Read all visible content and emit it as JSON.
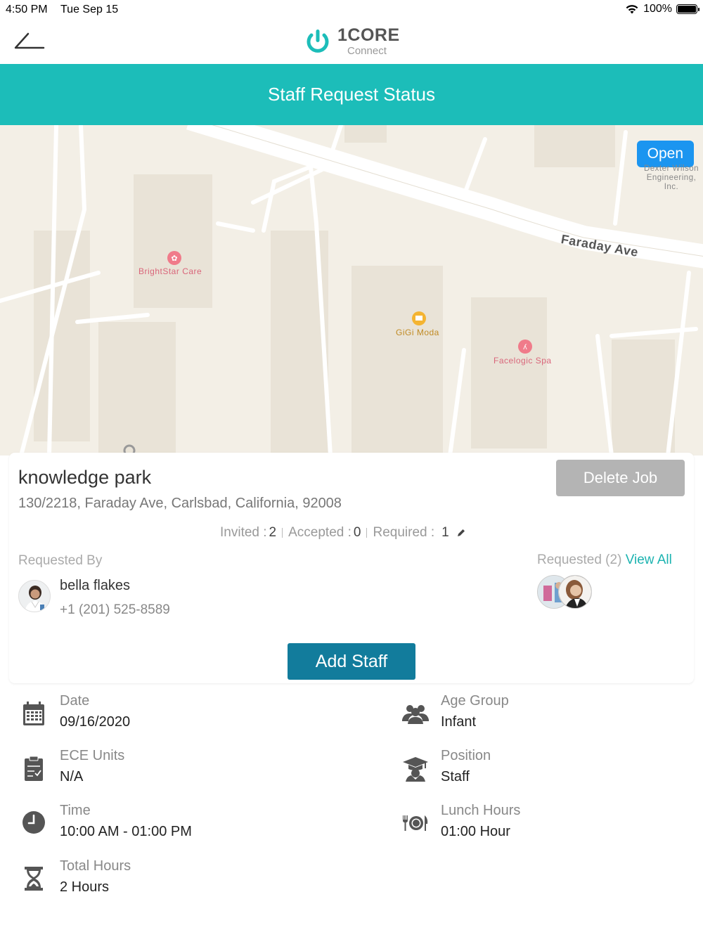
{
  "status_bar": {
    "time": "4:50 PM",
    "date": "Tue Sep 15",
    "battery": "100%"
  },
  "nav": {
    "logo_main": "1CORE",
    "logo_sub": "Connect"
  },
  "header": {
    "title": "Staff Request Status"
  },
  "map": {
    "open_label": "Open",
    "street": "Faraday Ave",
    "pois": [
      {
        "name": "BrightStar Care"
      },
      {
        "name": "GiGi Moda"
      },
      {
        "name": "Facelogic Spa"
      },
      {
        "name": "Dexter Wilson Engineering, Inc."
      }
    ]
  },
  "job": {
    "title": "knowledge park",
    "address": "130/2218, Faraday Ave, Carlsbad, California, 92008",
    "delete_label": "Delete Job",
    "invited_label": "Invited :",
    "invited_count": "2",
    "accepted_label": "Accepted :",
    "accepted_count": "0",
    "required_label": "Required :",
    "required_count": "1",
    "requested_by_label": "Requested By",
    "requester_name": "bella flakes",
    "requester_phone": "+1 (201) 525-8589",
    "requested_label": "Requested (2)",
    "view_all_label": "View All",
    "add_staff_label": "Add Staff"
  },
  "details": {
    "date": {
      "label": "Date",
      "value": "09/16/2020"
    },
    "age_group": {
      "label": "Age Group",
      "value": "Infant"
    },
    "ece_units": {
      "label": "ECE Units",
      "value": "N/A"
    },
    "position": {
      "label": "Position",
      "value": "Staff"
    },
    "time": {
      "label": "Time",
      "value": "10:00 AM - 01:00 PM"
    },
    "lunch_hours": {
      "label": "Lunch Hours",
      "value": "01:00 Hour"
    },
    "total_hours": {
      "label": "Total Hours",
      "value": "2 Hours"
    }
  },
  "colors": {
    "teal": "#1cbdb9",
    "button_blue": "#127c9c",
    "open_blue": "#1b95f0",
    "delete_gray": "#b4b4b4"
  }
}
